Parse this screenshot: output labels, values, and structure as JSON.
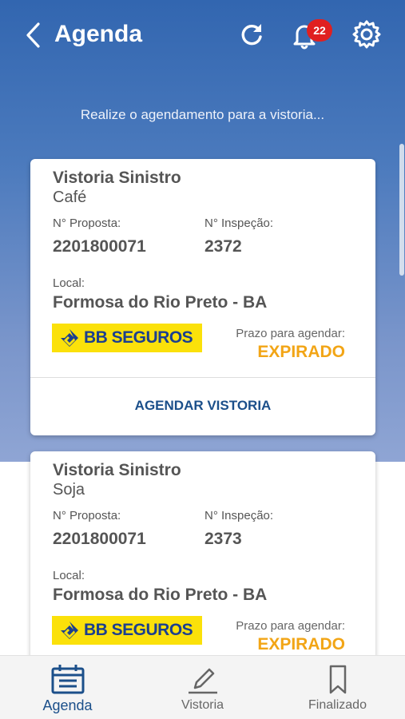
{
  "header": {
    "title": "Agenda",
    "notification_count": "22",
    "back_icon": "chevron-left-icon",
    "refresh_icon": "refresh-icon",
    "bell_icon": "bell-icon",
    "settings_icon": "gear-icon"
  },
  "subtitle": "Realize o agendamento para a vistoria...",
  "cards": [
    {
      "title": "Vistoria Sinistro",
      "crop": "Café",
      "proposta_label": "N° Proposta:",
      "proposta_value": "2201800071",
      "inspecao_label": "N° Inspeção:",
      "inspecao_value": "2372",
      "local_label": "Local:",
      "local_value": "Formosa do Rio Preto - BA",
      "logo_text": "BB SEGUROS",
      "prazo_label": "Prazo para agendar:",
      "prazo_value": "EXPIRADO",
      "action_label": "AGENDAR VISTORIA"
    },
    {
      "title": "Vistoria Sinistro",
      "crop": "Soja",
      "proposta_label": "N° Proposta:",
      "proposta_value": "2201800071",
      "inspecao_label": "N° Inspeção:",
      "inspecao_value": "2373",
      "local_label": "Local:",
      "local_value": "Formosa do Rio Preto - BA",
      "logo_text": "BB SEGUROS",
      "prazo_label": "Prazo para agendar:",
      "prazo_value": "EXPIRADO"
    }
  ],
  "nav": {
    "items": [
      {
        "label": "Agenda",
        "icon": "calendar-icon",
        "active": true
      },
      {
        "label": "Vistoria",
        "icon": "pencil-icon",
        "active": false
      },
      {
        "label": "Finalizado",
        "icon": "bookmark-icon",
        "active": false
      }
    ]
  },
  "colors": {
    "header_blue": "#3266b0",
    "accent_blue": "#1b4f8a",
    "expired_orange": "#f2a516",
    "badge_red": "#e02020",
    "logo_yellow": "#fbe10a"
  }
}
